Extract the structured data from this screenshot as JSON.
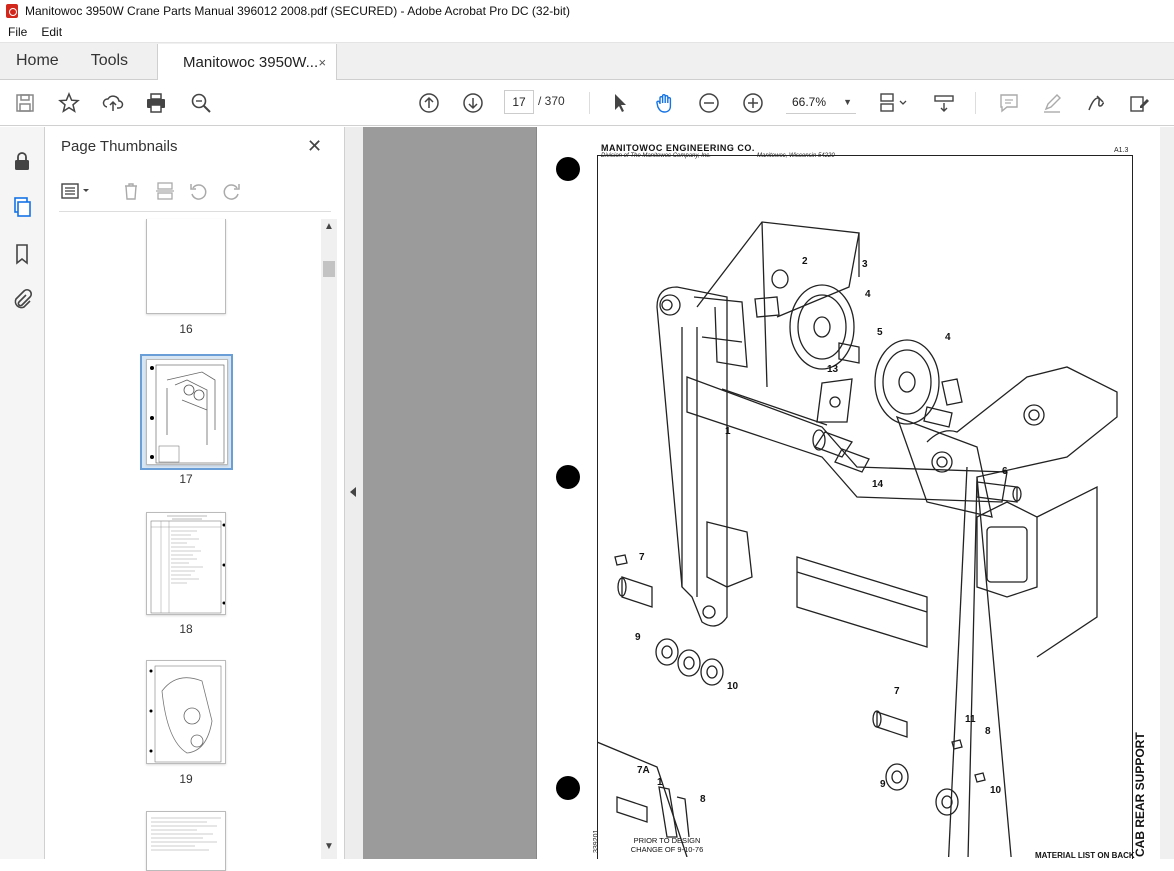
{
  "window": {
    "title": "Manitowoc 3950W Crane Parts Manual 396012 2008.pdf (SECURED) - Adobe Acrobat Pro DC (32-bit)"
  },
  "menu": {
    "file": "File",
    "edit": "Edit"
  },
  "tabs": {
    "home": "Home",
    "tools": "Tools",
    "document": "Manitowoc 3950W...",
    "close": "×"
  },
  "toolbar": {
    "current_page": "17",
    "total_pages": "/ 370",
    "zoom": "66.7%",
    "icons": [
      "save-icon",
      "star-icon",
      "upload-icon",
      "print-icon",
      "zoom-search-icon",
      "page-up-icon",
      "page-down-icon",
      "select-arrow-icon",
      "hand-icon",
      "zoom-out-icon",
      "zoom-in-icon",
      "page-layout-icon",
      "scroll-mode-icon",
      "comment-icon",
      "highlight-icon",
      "sign-icon",
      "edit-tools-icon"
    ]
  },
  "leftrail": {
    "icons": [
      "lock-icon",
      "page-thumbnails-icon",
      "bookmark-icon",
      "attachment-icon"
    ]
  },
  "thumbnails": {
    "title": "Page Thumbnails",
    "close": "✕",
    "pages": [
      {
        "label": "16"
      },
      {
        "label": "17",
        "selected": true
      },
      {
        "label": "18"
      },
      {
        "label": "19"
      }
    ]
  },
  "document": {
    "company": "MANITOWOC ENGINEERING CO.",
    "division": "Division of The Manitowoc Company, Inc.",
    "location": "Manitowoc, Wisconsin 54220",
    "sheet": "A1.3",
    "side_title": "CAB REAR SUPPORT",
    "drawing_number": "339201",
    "material_note": "MATERIAL LIST ON BACK",
    "inset_note": "PRIOR TO DESIGN CHANGE OF 9-10-76",
    "callouts": [
      "1",
      "2",
      "3",
      "4",
      "5",
      "4",
      "6",
      "7",
      "7",
      "8",
      "9",
      "9",
      "10",
      "10",
      "11",
      "13",
      "14",
      "7A",
      "1",
      "8"
    ]
  },
  "colors": {
    "accent": "#1473e6",
    "brand": "#d4271c",
    "selection": "#d8e6f4"
  }
}
